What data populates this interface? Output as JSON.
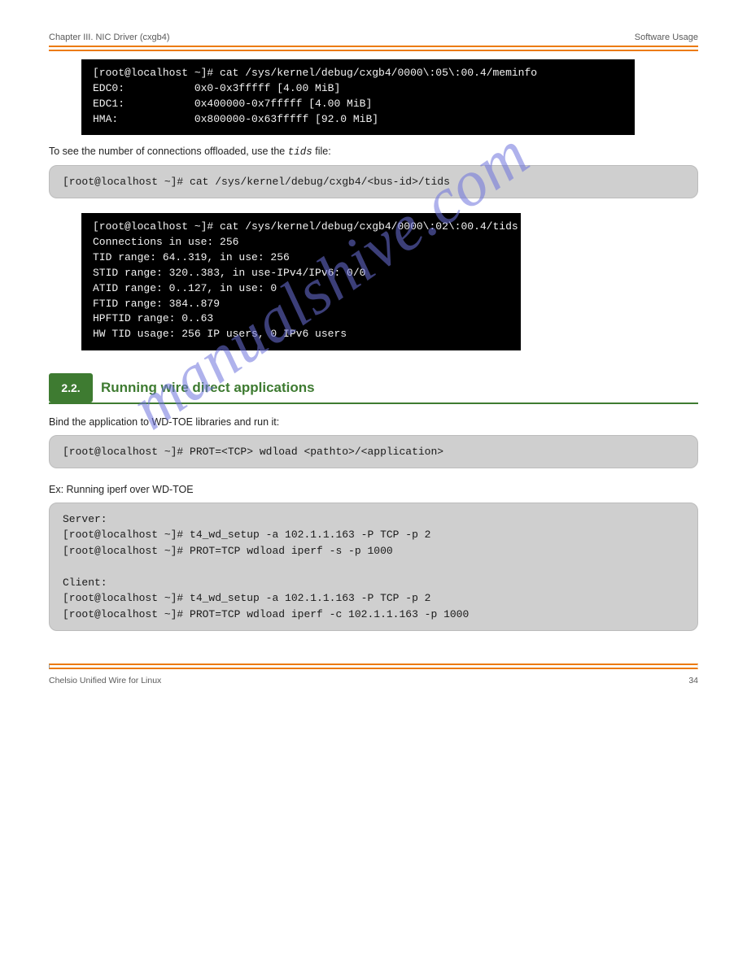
{
  "header": {
    "left": "Chapter III. NIC Driver (cxgb4)",
    "right": "Software Usage"
  },
  "terminal1": {
    "line1": "[root@localhost ~]# cat /sys/kernel/debug/cxgb4/0000\\:05\\:00.4/meminfo",
    "line2": "EDC0:           0x0-0x3fffff [4.00 MiB]",
    "line3": "EDC1:           0x400000-0x7fffff [4.00 MiB]",
    "line4": "HMA:            0x800000-0x63fffff [92.0 MiB]"
  },
  "para1_prefix": "To see the number of connections offloaded, use the ",
  "para1_mono": "tids",
  "para1_suffix": " file:",
  "codebox1": "[root@localhost ~]# cat /sys/kernel/debug/cxgb4/<bus-id>/tids",
  "terminal2": {
    "line1": "[root@localhost ~]# cat /sys/kernel/debug/cxgb4/0000\\:02\\:00.4/tids",
    "line2": "Connections in use: 256",
    "line3": "TID range: 64..319, in use: 256",
    "line4": "STID range: 320..383, in use-IPv4/IPv6: 0/0",
    "line5": "ATID range: 0..127, in use: 0",
    "line6": "FTID range: 384..879",
    "line7": "HPFTID range: 0..63",
    "line8": "HW TID usage: 256 IP users, 0 IPv6 users"
  },
  "section": {
    "num": "2.2.",
    "title": "Running wire direct applications"
  },
  "para2": "Bind the application to WD-TOE libraries and run it:",
  "codebox2": "[root@localhost ~]# PROT=<TCP> wdload <pathto>/<application>",
  "para3": "Ex: Running iperf over WD-TOE",
  "codebox3": {
    "label_server": "Server:",
    "line_s1": "[root@localhost ~]# t4_wd_setup -a 102.1.1.163 -P TCP -p 2",
    "line_s2": "[root@localhost ~]# PROT=TCP wdload iperf -s -p 1000",
    "label_client": "Client:",
    "line_c1": "[root@localhost ~]# t4_wd_setup -a 102.1.1.163 -P TCP -p 2",
    "line_c2": "[root@localhost ~]# PROT=TCP wdload iperf -c 102.1.1.163 -p 1000"
  },
  "footer": {
    "left": "Chelsio Unified Wire for Linux",
    "right": "34"
  },
  "watermark": "manualshive.com"
}
